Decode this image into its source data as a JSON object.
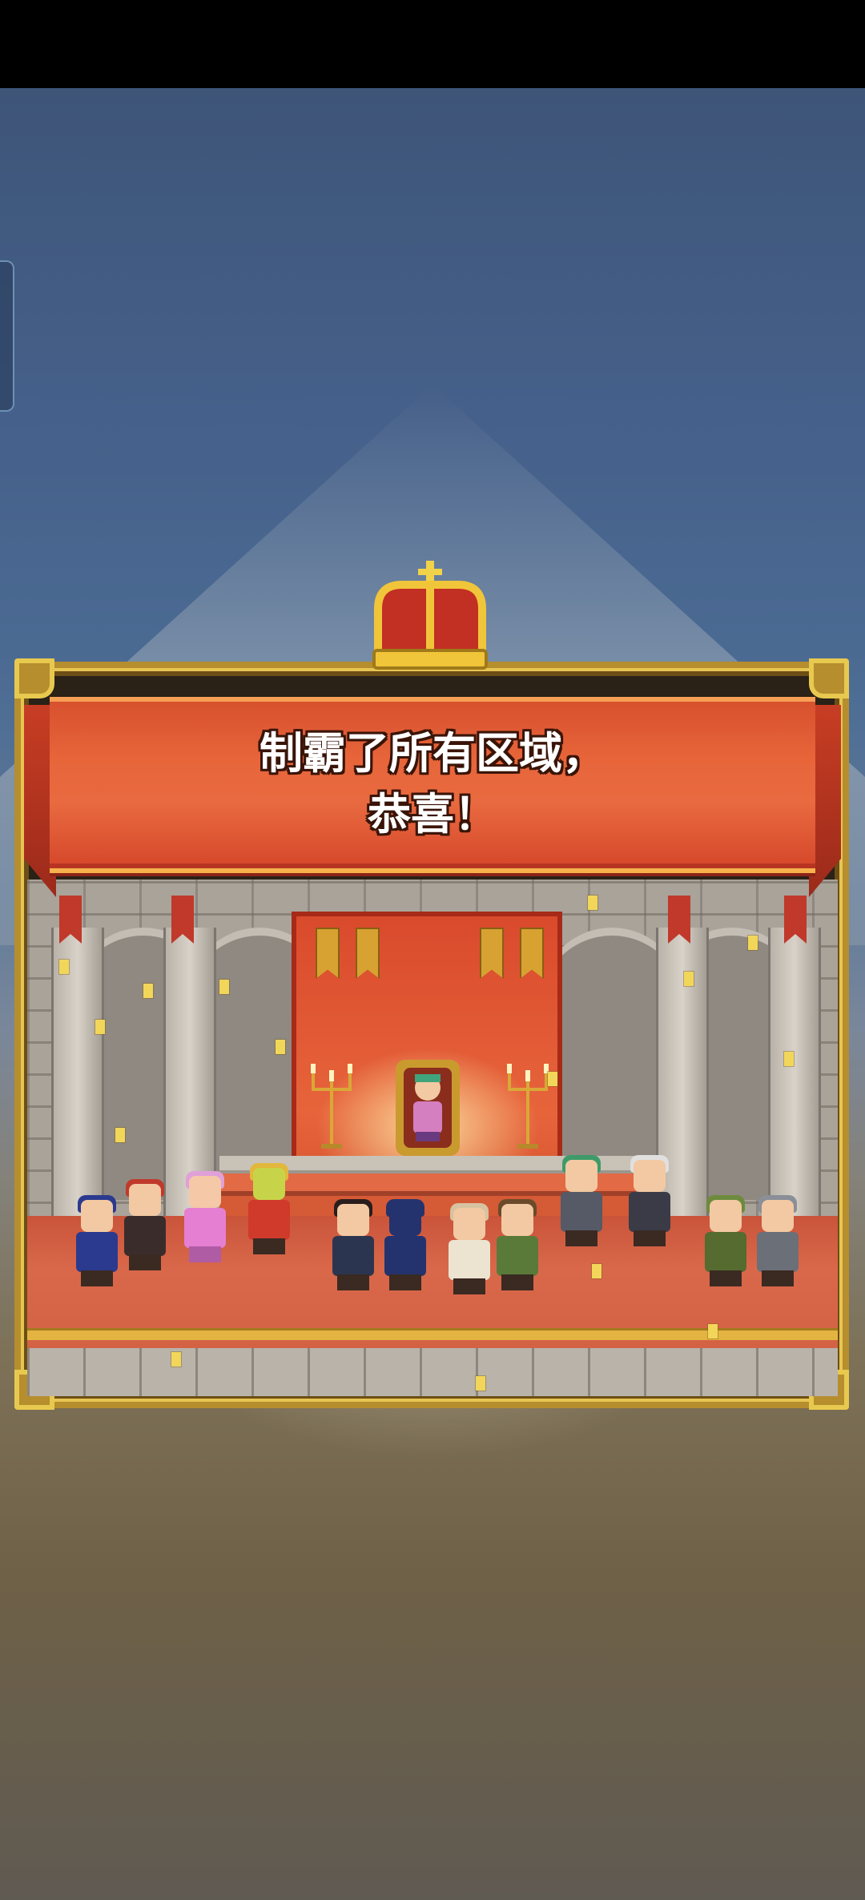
{
  "dialog": {
    "message_line1": "制霸了所有区域，",
    "message_line2": "恭喜！"
  },
  "icons": {
    "crown": "crown-icon"
  },
  "colors": {
    "banner": "#e8653a",
    "frame_gold": "#b68e2e",
    "carpet": "#d9684a"
  }
}
